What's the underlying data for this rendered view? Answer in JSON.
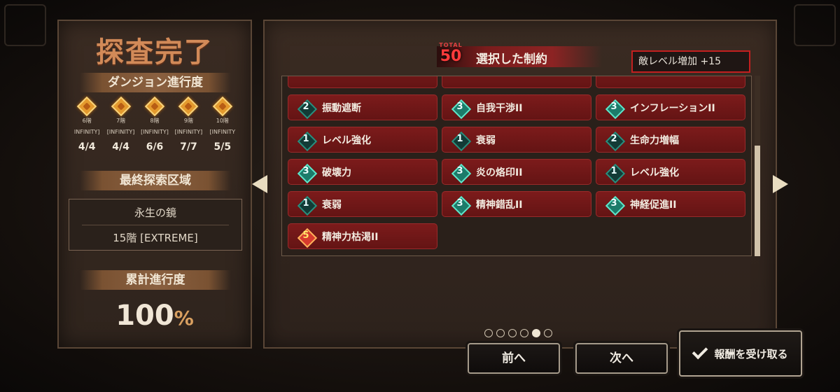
{
  "left": {
    "title": "探査完了",
    "progress_header": "ダンジョン進行度",
    "floors": [
      {
        "floor": "6階",
        "mode": "INFINITY]",
        "progress": "4/4"
      },
      {
        "floor": "7階",
        "mode": "[INFINITY]",
        "progress": "4/4"
      },
      {
        "floor": "8階",
        "mode": "[INFINITY]",
        "progress": "6/6"
      },
      {
        "floor": "9階",
        "mode": "[INFINITY]",
        "progress": "7/7"
      },
      {
        "floor": "10階",
        "mode": "[INFINITY",
        "progress": "5/5"
      }
    ],
    "last_area_header": "最終探索区域",
    "area_name": "永生の鏡",
    "area_floor": "15階 [EXTREME]",
    "total_header": "累計進行度",
    "total_value": "100",
    "total_unit": "%"
  },
  "main": {
    "total_label": "TOTAL",
    "total_value": "50",
    "title": "選択した制約",
    "enemy_level": "敵レベル増加 +15",
    "constraints": [
      {
        "level": "2",
        "label": "振動遮断"
      },
      {
        "level": "3",
        "label": "自我干渉II"
      },
      {
        "level": "3",
        "label": "インフレーションII"
      },
      {
        "level": "1",
        "label": "レベル強化"
      },
      {
        "level": "1",
        "label": "衰弱"
      },
      {
        "level": "2",
        "label": "生命力増幅"
      },
      {
        "level": "3",
        "label": "破壊力"
      },
      {
        "level": "3",
        "label": "炎の烙印II"
      },
      {
        "level": "1",
        "label": "レベル強化"
      },
      {
        "level": "1",
        "label": "衰弱"
      },
      {
        "level": "3",
        "label": "精神錯乱II"
      },
      {
        "level": "3",
        "label": "神経促進II"
      },
      {
        "level": "5",
        "label": "精神力枯渇II"
      }
    ],
    "page_dots": 6,
    "active_page": 5
  },
  "buttons": {
    "prev": "前へ",
    "next": "次へ",
    "reward": "報酬を受け取る"
  }
}
